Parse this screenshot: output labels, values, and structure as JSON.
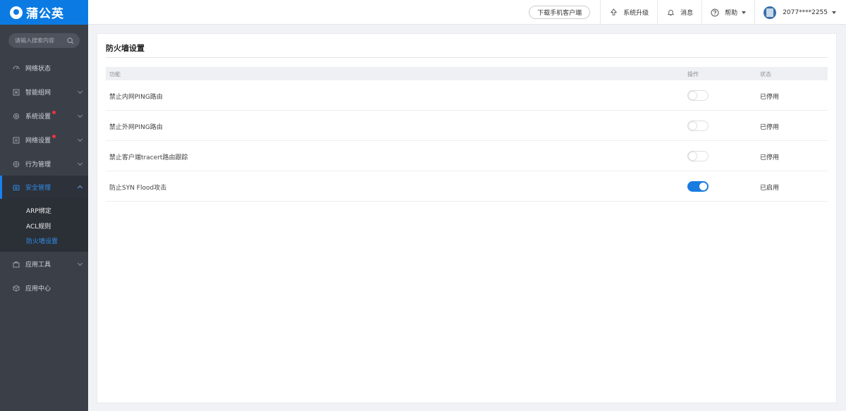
{
  "brand": {
    "name": "蒲公英"
  },
  "header": {
    "download_label": "下载手机客户端",
    "upgrade_label": "系统升级",
    "messages_label": "消息",
    "help_label": "帮助",
    "account_label": "2077****2255"
  },
  "sidebar": {
    "search_placeholder": "请输入搜索内容",
    "items": [
      {
        "label": "网络状态",
        "icon": "network-status-icon"
      },
      {
        "label": "智能组网",
        "icon": "smart-network-icon"
      },
      {
        "label": "系统设置",
        "icon": "gear-icon",
        "badge": true
      },
      {
        "label": "网络设置",
        "icon": "network-settings-icon",
        "badge": true
      },
      {
        "label": "行为管理",
        "icon": "behavior-icon"
      },
      {
        "label": "安全管理",
        "icon": "security-icon",
        "expanded": true
      },
      {
        "label": "应用工具",
        "icon": "toolbox-icon"
      },
      {
        "label": "应用中心",
        "icon": "app-center-icon"
      }
    ],
    "sub_items": [
      {
        "label": "ARP绑定"
      },
      {
        "label": "ACL规则"
      },
      {
        "label": "防火墙设置",
        "active": true
      }
    ]
  },
  "main": {
    "title": "防火墙设置",
    "columns": {
      "feature": "功能",
      "action": "操作",
      "status": "状态"
    },
    "rows": [
      {
        "feature": "禁止内网PING路由",
        "enabled": false,
        "status": "已停用"
      },
      {
        "feature": "禁止外网PING路由",
        "enabled": false,
        "status": "已停用"
      },
      {
        "feature": "禁止客户端tracert路由跟踪",
        "enabled": false,
        "status": "已停用"
      },
      {
        "feature": "防止SYN Flood攻击",
        "enabled": true,
        "status": "已启用"
      }
    ]
  },
  "colors": {
    "brand_blue": "#0b7be3",
    "sidebar_bg": "#3b3f48",
    "switch_on": "#1a7be0",
    "badge_red": "#f0323c"
  }
}
